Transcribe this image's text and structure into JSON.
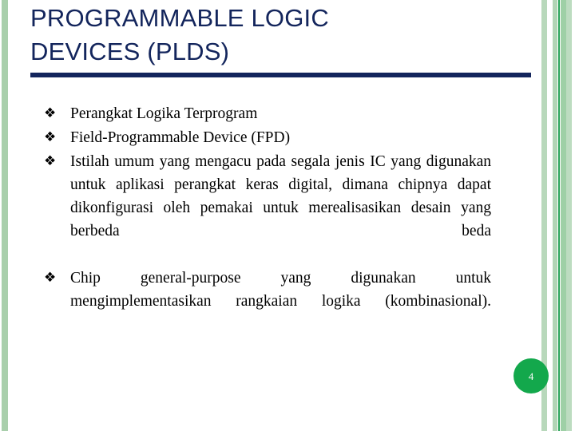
{
  "slide": {
    "title": "PROGRAMMABLE LOGIC\nDEVICES (PLDS)",
    "page_number": "4",
    "bullet_glyph": "❖",
    "colors": {
      "title_navy": "#13255c",
      "rule_navy": "#13255c",
      "band_light_green": "#a9cfac",
      "band_accent_green": "#2aa55a",
      "badge_green": "#13a84c",
      "body_text": "#000000",
      "background": "#ffffff"
    },
    "bullets": [
      {
        "text": "Perangkat Logika Terprogram",
        "justified": false
      },
      {
        "text": "Field-Programmable Device (FPD)",
        "justified": false
      },
      {
        "text": "Istilah umum yang mengacu pada segala jenis IC yang digunakan untuk aplikasi perangkat keras digital, dimana chipnya dapat dikonfigurasi oleh pemakai untuk merealisasikan desain yang berbeda beda",
        "justified": true
      },
      {
        "text": "Chip general-purpose yang digunakan untuk mengimplementasikan rangkaian logika (kombinasional).",
        "justified": true
      }
    ]
  }
}
